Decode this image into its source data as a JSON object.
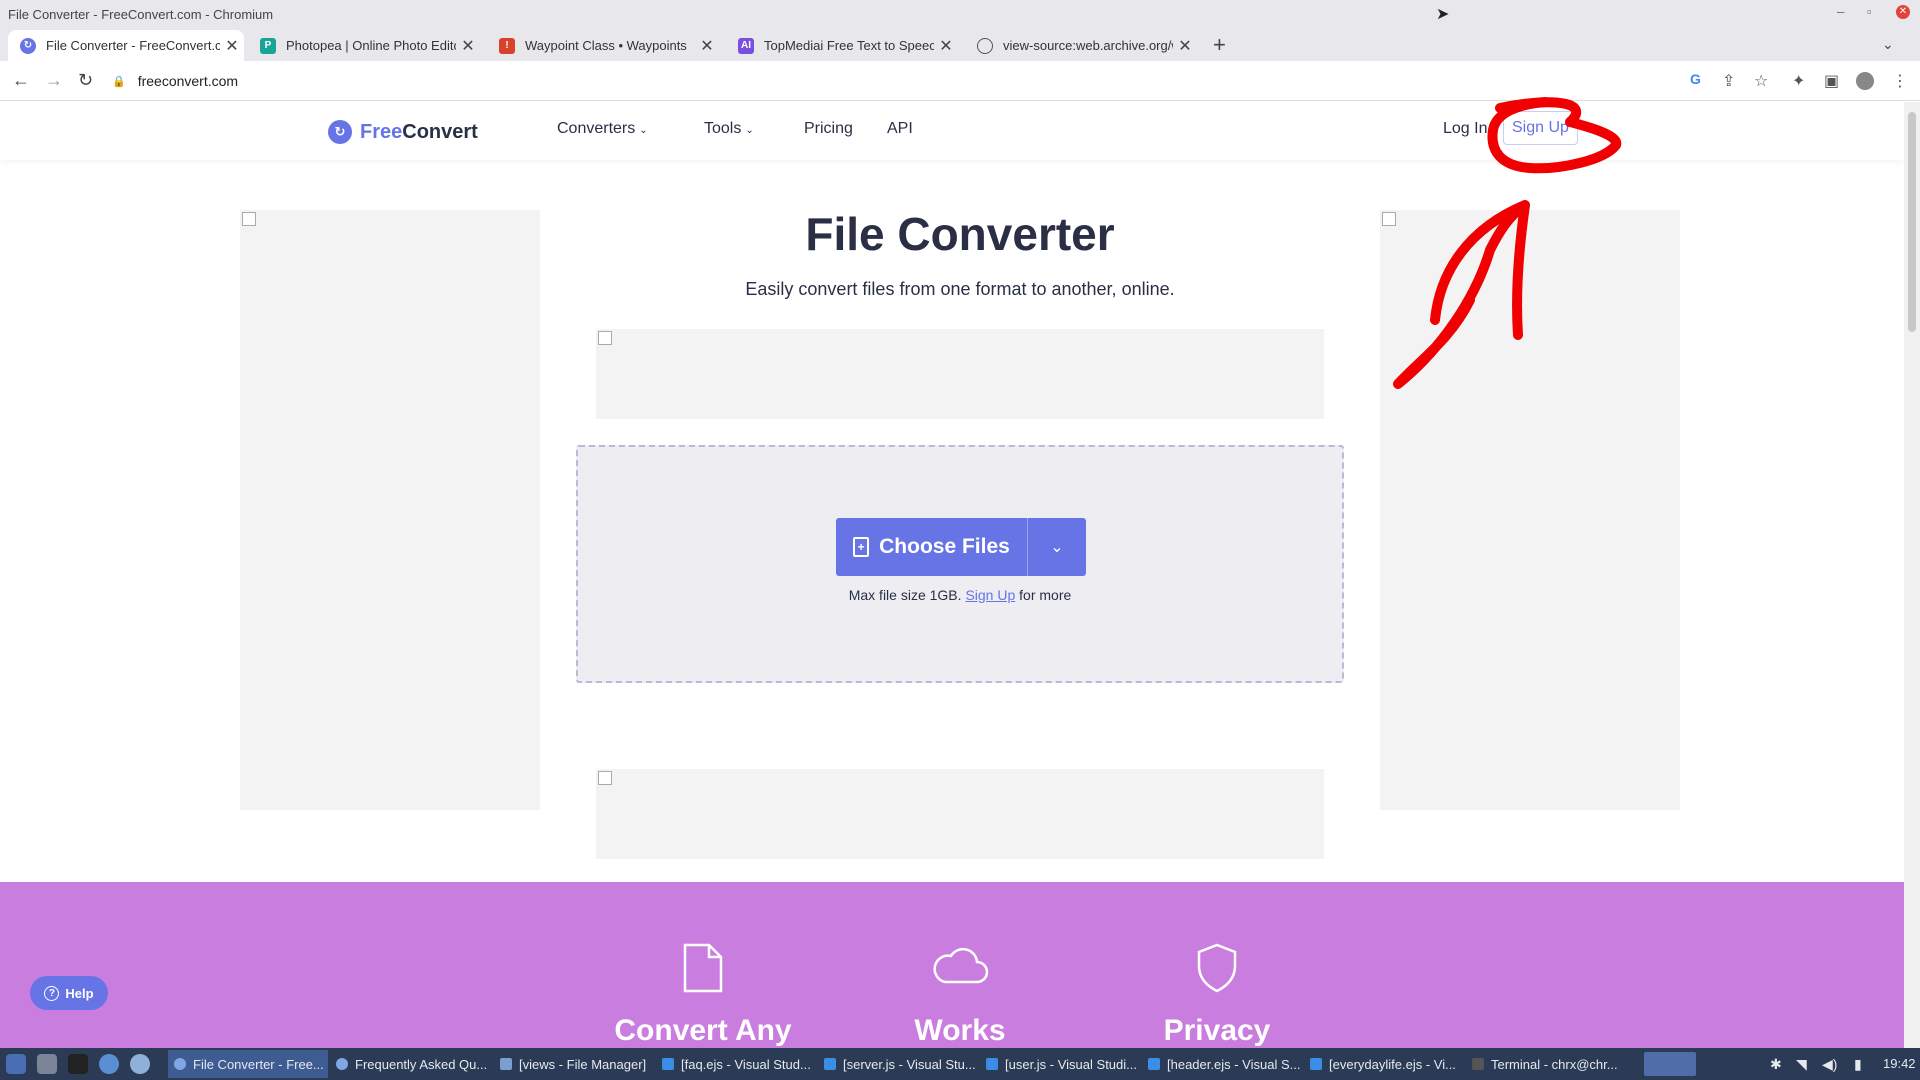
{
  "window": {
    "title": "File Converter - FreeConvert.com - Chromium"
  },
  "tabs": [
    {
      "label": "File Converter - FreeConvert.com",
      "active": true,
      "color": "#6674e6"
    },
    {
      "label": "Photopea | Online Photo Editor",
      "active": false,
      "color": "#18a497"
    },
    {
      "label": "Waypoint Class • Waypoints",
      "active": false,
      "color": "#d9412b"
    },
    {
      "label": "TopMediai Free Text to Speech",
      "active": false,
      "color": "#7a4fe0"
    },
    {
      "label": "view-source:web.archive.org/w",
      "active": false,
      "color": "#555555"
    }
  ],
  "address": {
    "url": "freeconvert.com"
  },
  "site": {
    "logo_free": "Free",
    "logo_convert": "Convert",
    "nav": {
      "converters": "Converters",
      "tools": "Tools",
      "pricing": "Pricing",
      "api": "API"
    },
    "login": "Log In",
    "signup": "Sign Up",
    "brand_color": "#6674e6"
  },
  "hero": {
    "title": "File Converter",
    "subtitle": "Easily convert files from one format to another, online.",
    "choose_files": "Choose Files",
    "max_prefix": "Max file size 1GB.",
    "max_link": "Sign Up",
    "max_suffix": "for more"
  },
  "features": [
    {
      "icon": "file-icon",
      "title": "Convert Any"
    },
    {
      "icon": "cloud-icon",
      "title": "Works"
    },
    {
      "icon": "shield-icon",
      "title": "Privacy"
    }
  ],
  "help": {
    "label": "Help"
  },
  "taskbar": {
    "items": [
      {
        "label": "File Converter - Free...",
        "active": true
      },
      {
        "label": "Frequently Asked Qu...",
        "active": false
      },
      {
        "label": "[views - File Manager]",
        "active": false
      },
      {
        "label": "[faq.ejs - Visual Stud...",
        "active": false
      },
      {
        "label": "[server.js - Visual Stu...",
        "active": false
      },
      {
        "label": "[user.js - Visual Studi...",
        "active": false
      },
      {
        "label": "[header.ejs - Visual S...",
        "active": false
      },
      {
        "label": "[everydaylife.ejs - Vi...",
        "active": false
      },
      {
        "label": "Terminal - chrx@chr...",
        "active": false
      }
    ],
    "clock": "19:42"
  }
}
